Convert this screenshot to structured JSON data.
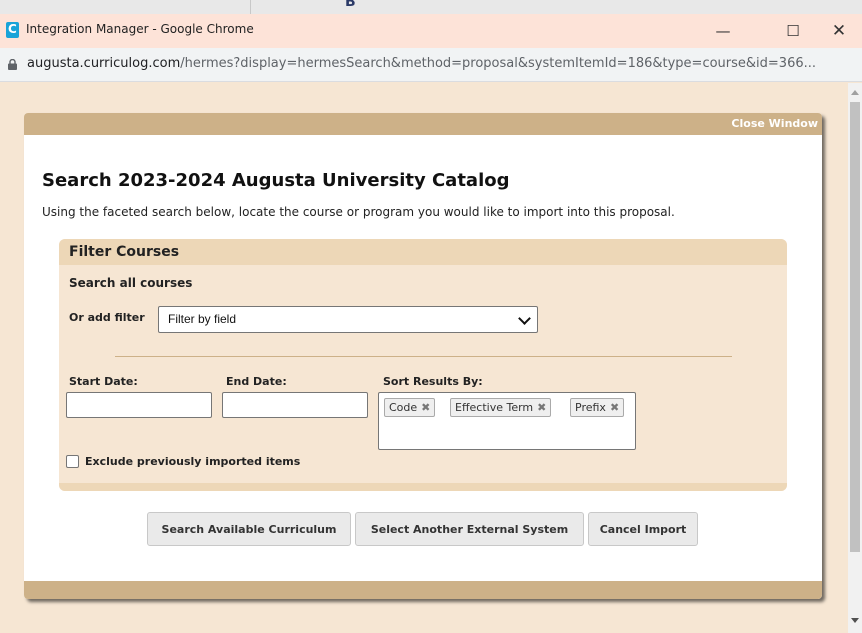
{
  "browser": {
    "window_title": "Integration Manager - Google Chrome",
    "app_icon_letter": "C",
    "controls": {
      "minimize": "—",
      "maximize": "☐",
      "close": "✕"
    },
    "url_host": "augusta.curriculog.com",
    "url_path": "/hermes?display=hermesSearch&method=proposal&systemItemId=186&type=course&id=366..."
  },
  "background_glyph": "B",
  "modal": {
    "close_label": "Close Window",
    "title": "Search 2023-2024 Augusta University Catalog",
    "description": "Using the faceted search below, locate the course or program you would like to import into this proposal."
  },
  "filter": {
    "title": "Filter Courses",
    "search_all": "Search all courses",
    "add_filter_label": "Or add filter",
    "select_value": "Filter by field",
    "start_date_label": "Start Date:",
    "start_date_value": "",
    "end_date_label": "End Date:",
    "end_date_value": "",
    "sort_label": "Sort Results By:",
    "sort_tags": [
      "Code",
      "Effective Term",
      "Prefix"
    ],
    "tag_remove": "✖",
    "exclude_label": "Exclude previously imported items"
  },
  "actions": {
    "search": "Search Available Curriculum",
    "select_system": "Select Another External System",
    "cancel": "Cancel Import"
  },
  "colors": {
    "page_bg": "#f6e6d3",
    "header_tan": "#cdb188",
    "panel_header": "#edd7b7",
    "titlebar": "#fde3d8"
  }
}
